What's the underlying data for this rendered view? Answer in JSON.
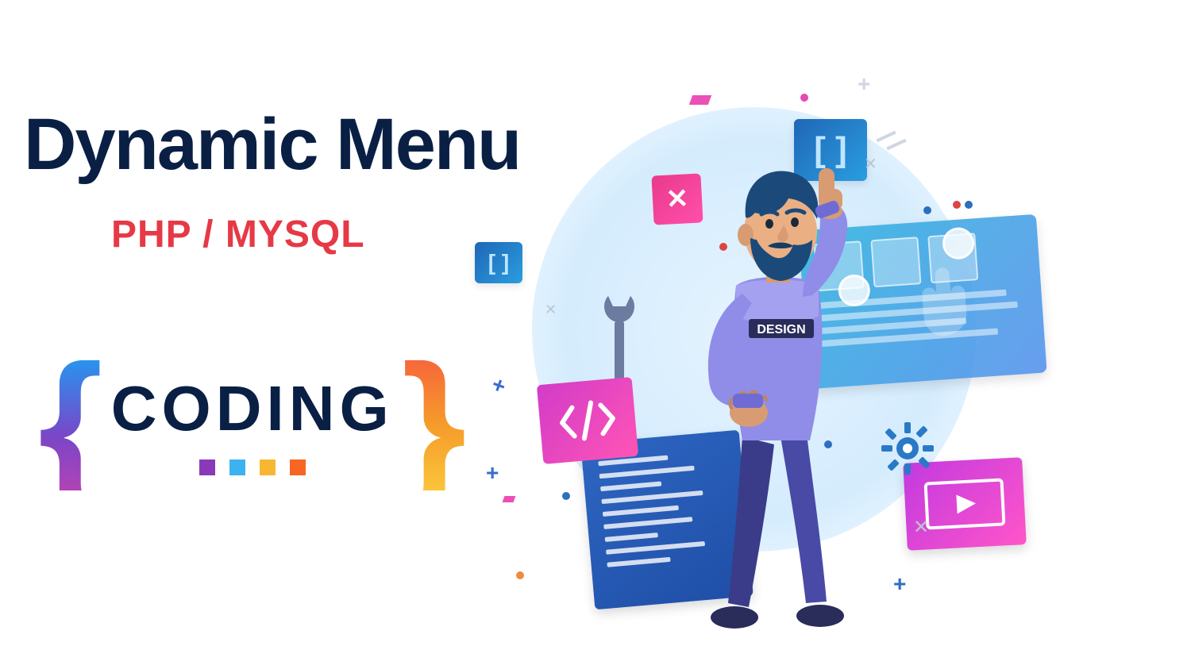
{
  "main_title": "Dynamic Menu",
  "sub_title": "PHP / MYSQL",
  "coding_logo": {
    "left_brace": "{",
    "word": "CODING",
    "right_brace": "}"
  },
  "illustration": {
    "shirt_label": "DESIGN",
    "brackets_glyph": "[ ]",
    "code_glyph": "</>",
    "x_glyph": "✕"
  },
  "colors": {
    "title": "#0a1f44",
    "subtitle": "#e63946",
    "brace_left_gradient": [
      "#2596f0",
      "#7a46c8",
      "#b143b5"
    ],
    "brace_right_gradient": [
      "#f7643b",
      "#f59b2a",
      "#fbc43a"
    ]
  }
}
